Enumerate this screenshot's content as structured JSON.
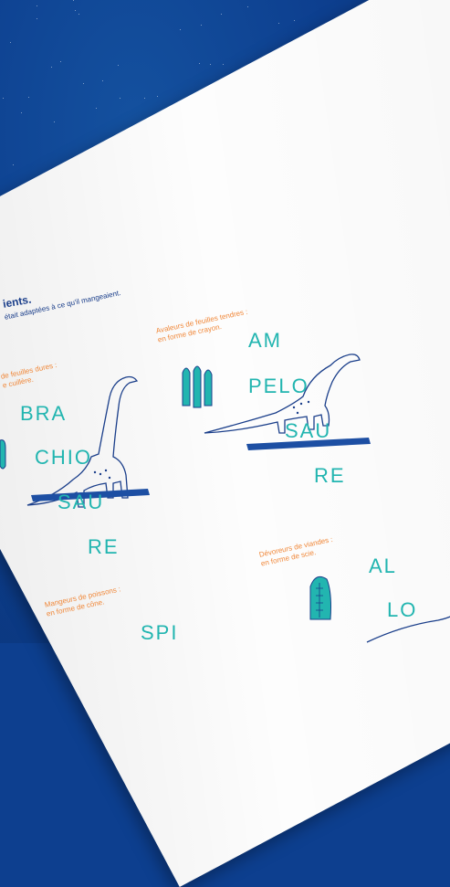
{
  "heading": "ients.",
  "subheading": "était adaptées à ce qu'il mangeaient.",
  "groups": [
    {
      "caption_line1": "de feuilles dures :",
      "caption_line2": "e cuillère.",
      "syllables": [
        "BRA",
        "CHIO",
        "SAU",
        "RE"
      ]
    },
    {
      "caption_line1": "Avaleurs de feuilles tendres :",
      "caption_line2": "en forme de crayon.",
      "syllables": [
        "AM",
        "PELO",
        "SAU",
        "RE"
      ]
    },
    {
      "caption_line1": "Dévoreurs de viandes :",
      "caption_line2": "en forme de scie.",
      "syllables": [
        "AL",
        "LO"
      ]
    },
    {
      "caption_line1": "Mangeurs de poissons :",
      "caption_line2": "en forme de cône.",
      "syllables": [
        "SPI"
      ]
    }
  ],
  "colors": {
    "background": "#0d3f8f",
    "paper": "#fdfdfd",
    "teal": "#22b5b0",
    "orange": "#f0883a",
    "navy": "#1a3e8a",
    "bar": "#1d4fa3"
  },
  "icons": [
    "spoon-teeth-icon",
    "pencil-teeth-icon",
    "saw-tooth-icon",
    "brachiosaurus-icon",
    "amphicoelias-icon"
  ]
}
